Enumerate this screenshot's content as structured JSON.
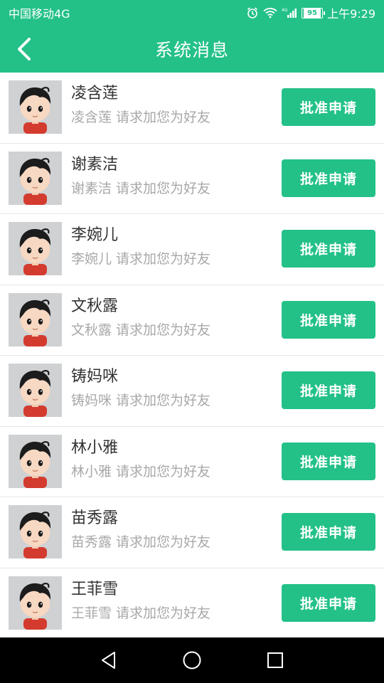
{
  "status_bar": {
    "carrier": "中国移动4G",
    "battery": "95",
    "time": "上午9:29",
    "network_label": "4G"
  },
  "header": {
    "title": "系统消息",
    "back_icon": "chevron-left-icon"
  },
  "colors": {
    "accent": "#23c188",
    "name_text": "#333333",
    "message_text": "#a8a8a8"
  },
  "requests": [
    {
      "name": "凌含莲",
      "message": "凌含莲 请求加您为好友",
      "button": "批准申请"
    },
    {
      "name": "谢素洁",
      "message": "谢素洁 请求加您为好友",
      "button": "批准申请"
    },
    {
      "name": "李婉儿",
      "message": "李婉儿 请求加您为好友",
      "button": "批准申请"
    },
    {
      "name": "文秋露",
      "message": "文秋露 请求加您为好友",
      "button": "批准申请"
    },
    {
      "name": "铸妈咪",
      "message": "铸妈咪 请求加您为好友",
      "button": "批准申请"
    },
    {
      "name": "林小雅",
      "message": "林小雅 请求加您为好友",
      "button": "批准申请"
    },
    {
      "name": "苗秀露",
      "message": "苗秀露 请求加您为好友",
      "button": "批准申请"
    },
    {
      "name": "王菲雪",
      "message": "王菲雪 请求加您为好友",
      "button": "批准申请"
    }
  ],
  "nav_bar": {
    "back": "triangle-back-icon",
    "home": "circle-home-icon",
    "recents": "square-recents-icon"
  }
}
